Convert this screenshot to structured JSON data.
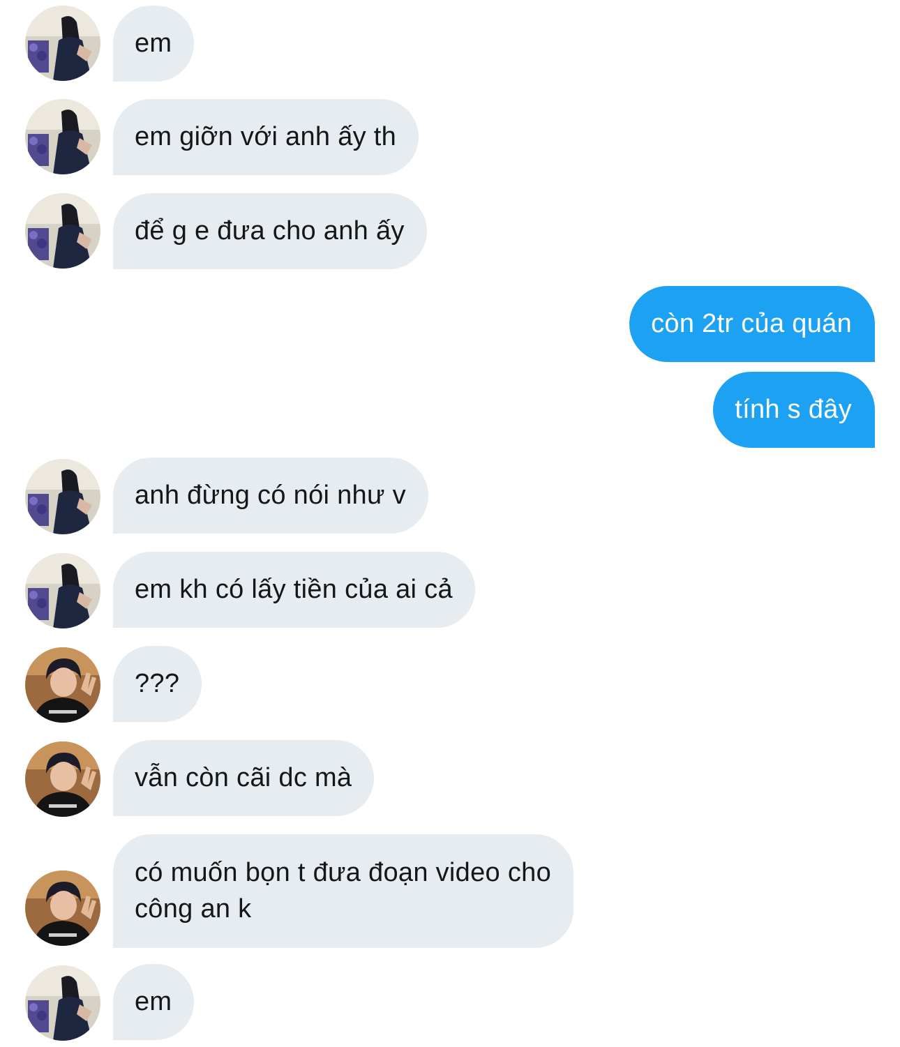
{
  "participants": {
    "female_user": {
      "avatar_icon": "profile-photo-woman-icon"
    },
    "male_user": {
      "avatar_icon": "profile-photo-man-icon"
    },
    "self": {}
  },
  "colors": {
    "incoming_bubble": "#e6ecf0",
    "outgoing_bubble": "#1da1f2",
    "incoming_text": "#14171a",
    "outgoing_text": "#ffffff"
  },
  "messages": [
    {
      "sender": "female_user",
      "direction": "incoming",
      "text": "em"
    },
    {
      "sender": "female_user",
      "direction": "incoming",
      "text": "em giỡn với anh ấy th"
    },
    {
      "sender": "female_user",
      "direction": "incoming",
      "text": "để g e đưa cho anh ấy"
    },
    {
      "sender": "self",
      "direction": "outgoing",
      "text": "còn 2tr của quán"
    },
    {
      "sender": "self",
      "direction": "outgoing",
      "text": "tính s đây"
    },
    {
      "sender": "female_user",
      "direction": "incoming",
      "text": "anh đừng có nói như v"
    },
    {
      "sender": "female_user",
      "direction": "incoming",
      "text": "em kh có lấy tiền của ai cả"
    },
    {
      "sender": "male_user",
      "direction": "incoming",
      "text": "???"
    },
    {
      "sender": "male_user",
      "direction": "incoming",
      "text": "vẫn còn cãi dc mà"
    },
    {
      "sender": "male_user",
      "direction": "incoming",
      "lines": [
        "có muốn bọn t đưa đoạn video cho",
        "công an k"
      ]
    },
    {
      "sender": "female_user",
      "direction": "incoming",
      "text": "em"
    }
  ]
}
